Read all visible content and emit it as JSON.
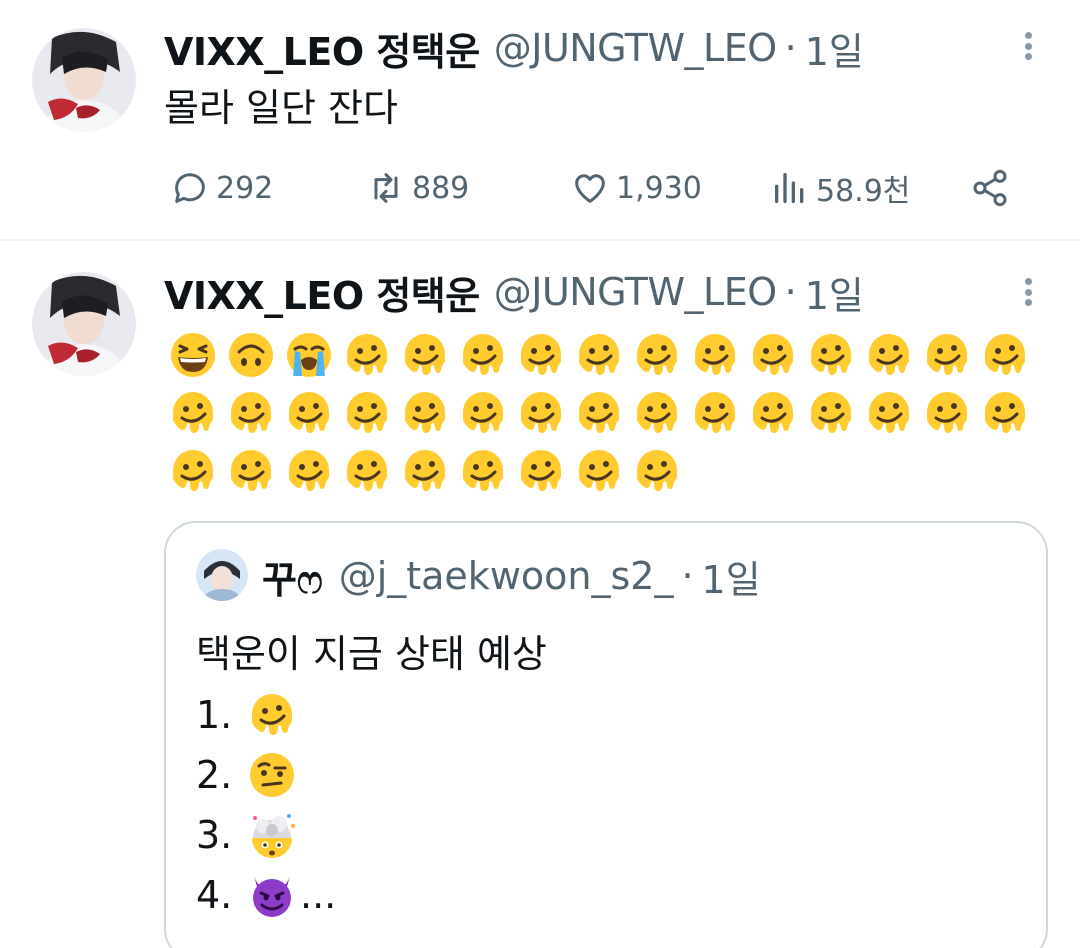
{
  "tweets": [
    {
      "display_name": "VIXX_LEO 정택운",
      "handle": "@JUNGTW_LEO",
      "separator": "·",
      "time": "1일",
      "text": "몰라 일단 잔다",
      "actions": {
        "replies": "292",
        "retweets": "889",
        "likes": "1,930",
        "views": "58.9천"
      }
    },
    {
      "display_name": "VIXX_LEO 정택운",
      "handle": "@JUNGTW_LEO",
      "separator": "·",
      "time": "1일",
      "emoji_rows": [
        [
          "grinning-squinting-face",
          "upside-down-face",
          "loudly-crying-face",
          "melting-face",
          "melting-face",
          "melting-face",
          "melting-face",
          "melting-face",
          "melting-face",
          "melting-face",
          "melting-face",
          "melting-face",
          "melting-face",
          "melting-face",
          "melting-face"
        ],
        [
          "melting-face",
          "melting-face",
          "melting-face",
          "melting-face",
          "melting-face",
          "melting-face",
          "melting-face",
          "melting-face",
          "melting-face",
          "melting-face",
          "melting-face",
          "melting-face",
          "melting-face",
          "melting-face",
          "melting-face"
        ],
        [
          "melting-face",
          "melting-face",
          "melting-face",
          "melting-face",
          "melting-face",
          "melting-face",
          "melting-face",
          "melting-face",
          "melting-face"
        ]
      ],
      "quote": {
        "display_name": "꾸ෆ",
        "handle": "@j_taekwoon_s2_",
        "separator": "·",
        "time": "1일",
        "text": "택운이 지금 상태 예상",
        "list": [
          {
            "num": "1.",
            "emoji": "melting-face",
            "suffix": ""
          },
          {
            "num": "2.",
            "emoji": "face-with-raised-eyebrow",
            "suffix": ""
          },
          {
            "num": "3.",
            "emoji": "exploding-head",
            "suffix": ""
          },
          {
            "num": "4.",
            "emoji": "smiling-face-with-horns",
            "suffix": "..."
          }
        ]
      }
    }
  ],
  "colors": {
    "text": "#0f1419",
    "secondary": "#536471",
    "border": "#cfd9de",
    "divider": "#eff3f4"
  }
}
